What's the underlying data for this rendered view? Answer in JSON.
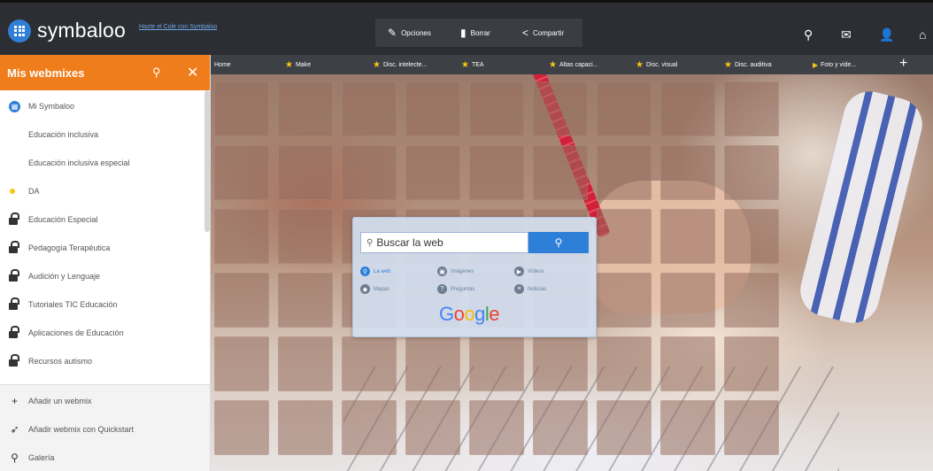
{
  "header": {
    "logo_text": "symbaloo",
    "teacher_link": "Hazte el Cole con Symbaloo",
    "tools": [
      {
        "label": "Opciones",
        "icon": "pencil-icon"
      },
      {
        "label": "Borrar",
        "icon": "trash-icon"
      },
      {
        "label": "Compartir",
        "icon": "share-icon"
      }
    ],
    "right_icons": [
      "search-icon",
      "mail-icon",
      "user-icon",
      "home-icon"
    ]
  },
  "tabs": [
    {
      "label": "Home",
      "icon": ""
    },
    {
      "label": "Make",
      "icon": "star-icon"
    },
    {
      "label": "Disc. intelecte...",
      "icon": "star-icon"
    },
    {
      "label": "TEA",
      "icon": "star-icon"
    },
    {
      "label": "Altas capaci...",
      "icon": "star-icon"
    },
    {
      "label": "Disc. visual",
      "icon": "star-icon"
    },
    {
      "label": "Disc. auditiva",
      "icon": "star-icon"
    },
    {
      "label": "Foto y vide...",
      "icon": "play-icon"
    }
  ],
  "search_widget": {
    "placeholder": "Buscar la web",
    "options": [
      {
        "label": "La web",
        "active": true
      },
      {
        "label": "Imágenes",
        "active": false
      },
      {
        "label": "Vídeos",
        "active": false
      },
      {
        "label": "Mapas",
        "active": false
      },
      {
        "label": "Preguntas",
        "active": false
      },
      {
        "label": "Noticias",
        "active": false
      }
    ],
    "brand": [
      "G",
      "o",
      "o",
      "g",
      "l",
      "e"
    ],
    "brand_colors": [
      "#4285F4",
      "#EA4335",
      "#FBBC05",
      "#4285F4",
      "#34A853",
      "#EA4335"
    ]
  },
  "sidebar": {
    "title": "Mis webmixes",
    "items": [
      {
        "label": "Mi Symbaloo",
        "kind": "logo"
      },
      {
        "label": "Educación inclusiva",
        "kind": "none"
      },
      {
        "label": "Educación inclusiva especial",
        "kind": "none"
      },
      {
        "label": "DA",
        "kind": "dot"
      },
      {
        "label": "Educación Especial",
        "kind": "lock"
      },
      {
        "label": "Pedagogía Terapéutica",
        "kind": "lock"
      },
      {
        "label": "Audición y Lenguaje",
        "kind": "lock"
      },
      {
        "label": "Tutoriales TIC Educación",
        "kind": "lock"
      },
      {
        "label": "Aplicaciones de Educación",
        "kind": "lock"
      },
      {
        "label": "Recursos autismo",
        "kind": "lock"
      }
    ],
    "actions": [
      {
        "label": "Añadir un webmix",
        "icon": "plus-icon"
      },
      {
        "label": "Añadir webmix con Quickstart",
        "icon": "rocket-icon"
      },
      {
        "label": "Galería",
        "icon": "search-icon"
      }
    ]
  },
  "colors": {
    "accent": "#f07d1c",
    "brand": "#2f7fd6",
    "topbar": "#2c2e33"
  }
}
